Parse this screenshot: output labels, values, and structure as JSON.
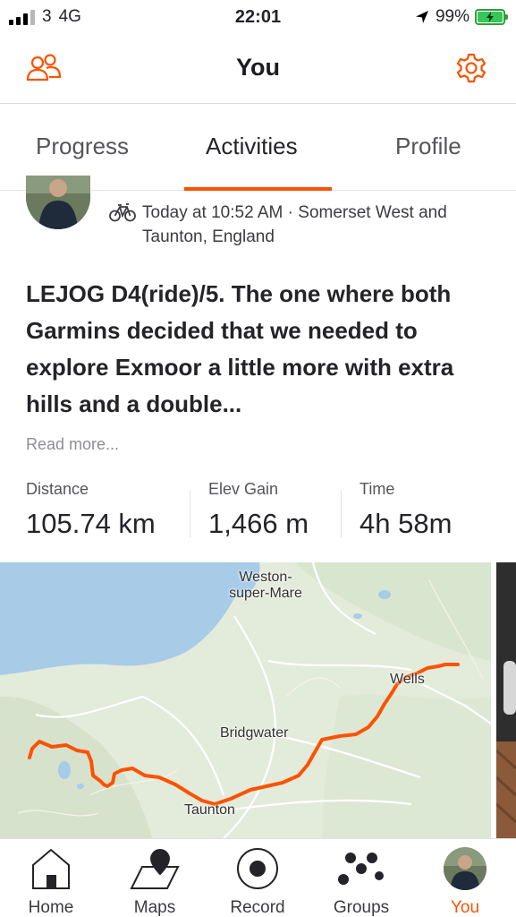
{
  "status_bar": {
    "carrier": "3",
    "network": "4G",
    "time": "22:01",
    "battery": "99%"
  },
  "header": {
    "title": "You",
    "left_icon": "friends-icon",
    "right_icon": "settings-gear-icon"
  },
  "tabs": [
    {
      "label": "Progress",
      "active": false
    },
    {
      "label": "Activities",
      "active": true
    },
    {
      "label": "Profile",
      "active": false
    }
  ],
  "activity": {
    "sport_icon": "bike-icon",
    "meta_line1": "Today at 10:52 AM · Somerset West and",
    "meta_line2": "Taunton, England",
    "title": "LEJOG D4(ride)/5. The one where both Garmins decided that we needed to explore Exmoor a little more with extra hills and a double...",
    "read_more": "Read more...",
    "stats": [
      {
        "label": "Distance",
        "value": "105.74 km"
      },
      {
        "label": "Elev Gain",
        "value": "1,466 m"
      },
      {
        "label": "Time",
        "value": "4h 58m"
      }
    ],
    "map": {
      "labels": {
        "weston_line1": "Weston-",
        "weston_line2": "super-Mare",
        "bridgwater": "Bridgwater",
        "taunton": "Taunton",
        "wells": "Wells"
      },
      "route_color": "#fc5200"
    }
  },
  "bottom_nav": [
    {
      "label": "Home",
      "icon": "home-icon",
      "active": false
    },
    {
      "label": "Maps",
      "icon": "map-pin-icon",
      "active": false
    },
    {
      "label": "Record",
      "icon": "record-icon",
      "active": false
    },
    {
      "label": "Groups",
      "icon": "groups-icon",
      "active": false
    },
    {
      "label": "You",
      "icon": "profile-avatar",
      "active": true
    }
  ],
  "colors": {
    "accent": "#fc5200",
    "text": "#242428",
    "muted": "#8e8e93"
  }
}
